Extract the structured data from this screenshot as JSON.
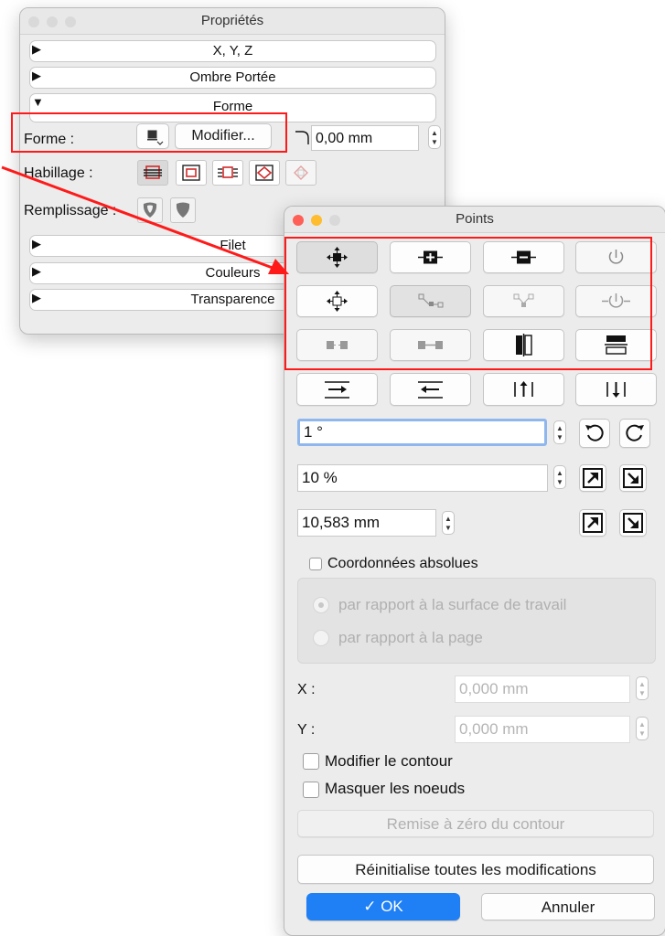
{
  "props_window": {
    "title": "Propriétés",
    "sections": [
      {
        "label": "X, Y, Z",
        "expanded": false
      },
      {
        "label": "Ombre Portée",
        "expanded": false
      },
      {
        "label": "Forme",
        "expanded": true
      },
      {
        "label": "Filet",
        "expanded": false
      },
      {
        "label": "Couleurs",
        "expanded": false
      },
      {
        "label": "Transparence",
        "expanded": false
      }
    ],
    "tri_closed": "▶",
    "tri_open": "▼",
    "forme_label": "Forme :",
    "modify_button": "Modifier...",
    "corner_value": "0,00 mm",
    "habillage_label": "Habillage :",
    "remplissage_label": "Remplissage :"
  },
  "points_window": {
    "title": "Points",
    "angle_value": "1 °",
    "scale_value": "10 %",
    "distance_value": "10,583 mm",
    "absolute_coords_label": "Coordonnées absolues",
    "radio_workspace": "par rapport à la surface de travail",
    "radio_page": "par rapport à la page",
    "x_label": "X :",
    "x_value": "0,000 mm",
    "y_label": "Y :",
    "y_value": "0,000 mm",
    "edit_contour_label": "Modifier le contour",
    "hide_nodes_label": "Masquer les noeuds",
    "reset_contour_button": "Remise à zéro du contour",
    "reset_all_button": "Réinitialise toutes les modifications",
    "ok_button": "OK",
    "ok_check": "✓",
    "cancel_button": "Annuler"
  },
  "colors": {
    "annotation_red": "#ff1a1a",
    "accent_blue": "#1f7ff5",
    "close_red": "#fe5f57",
    "minimize_yellow": "#febc2e",
    "disabled_gray": "#c6c6c6"
  }
}
